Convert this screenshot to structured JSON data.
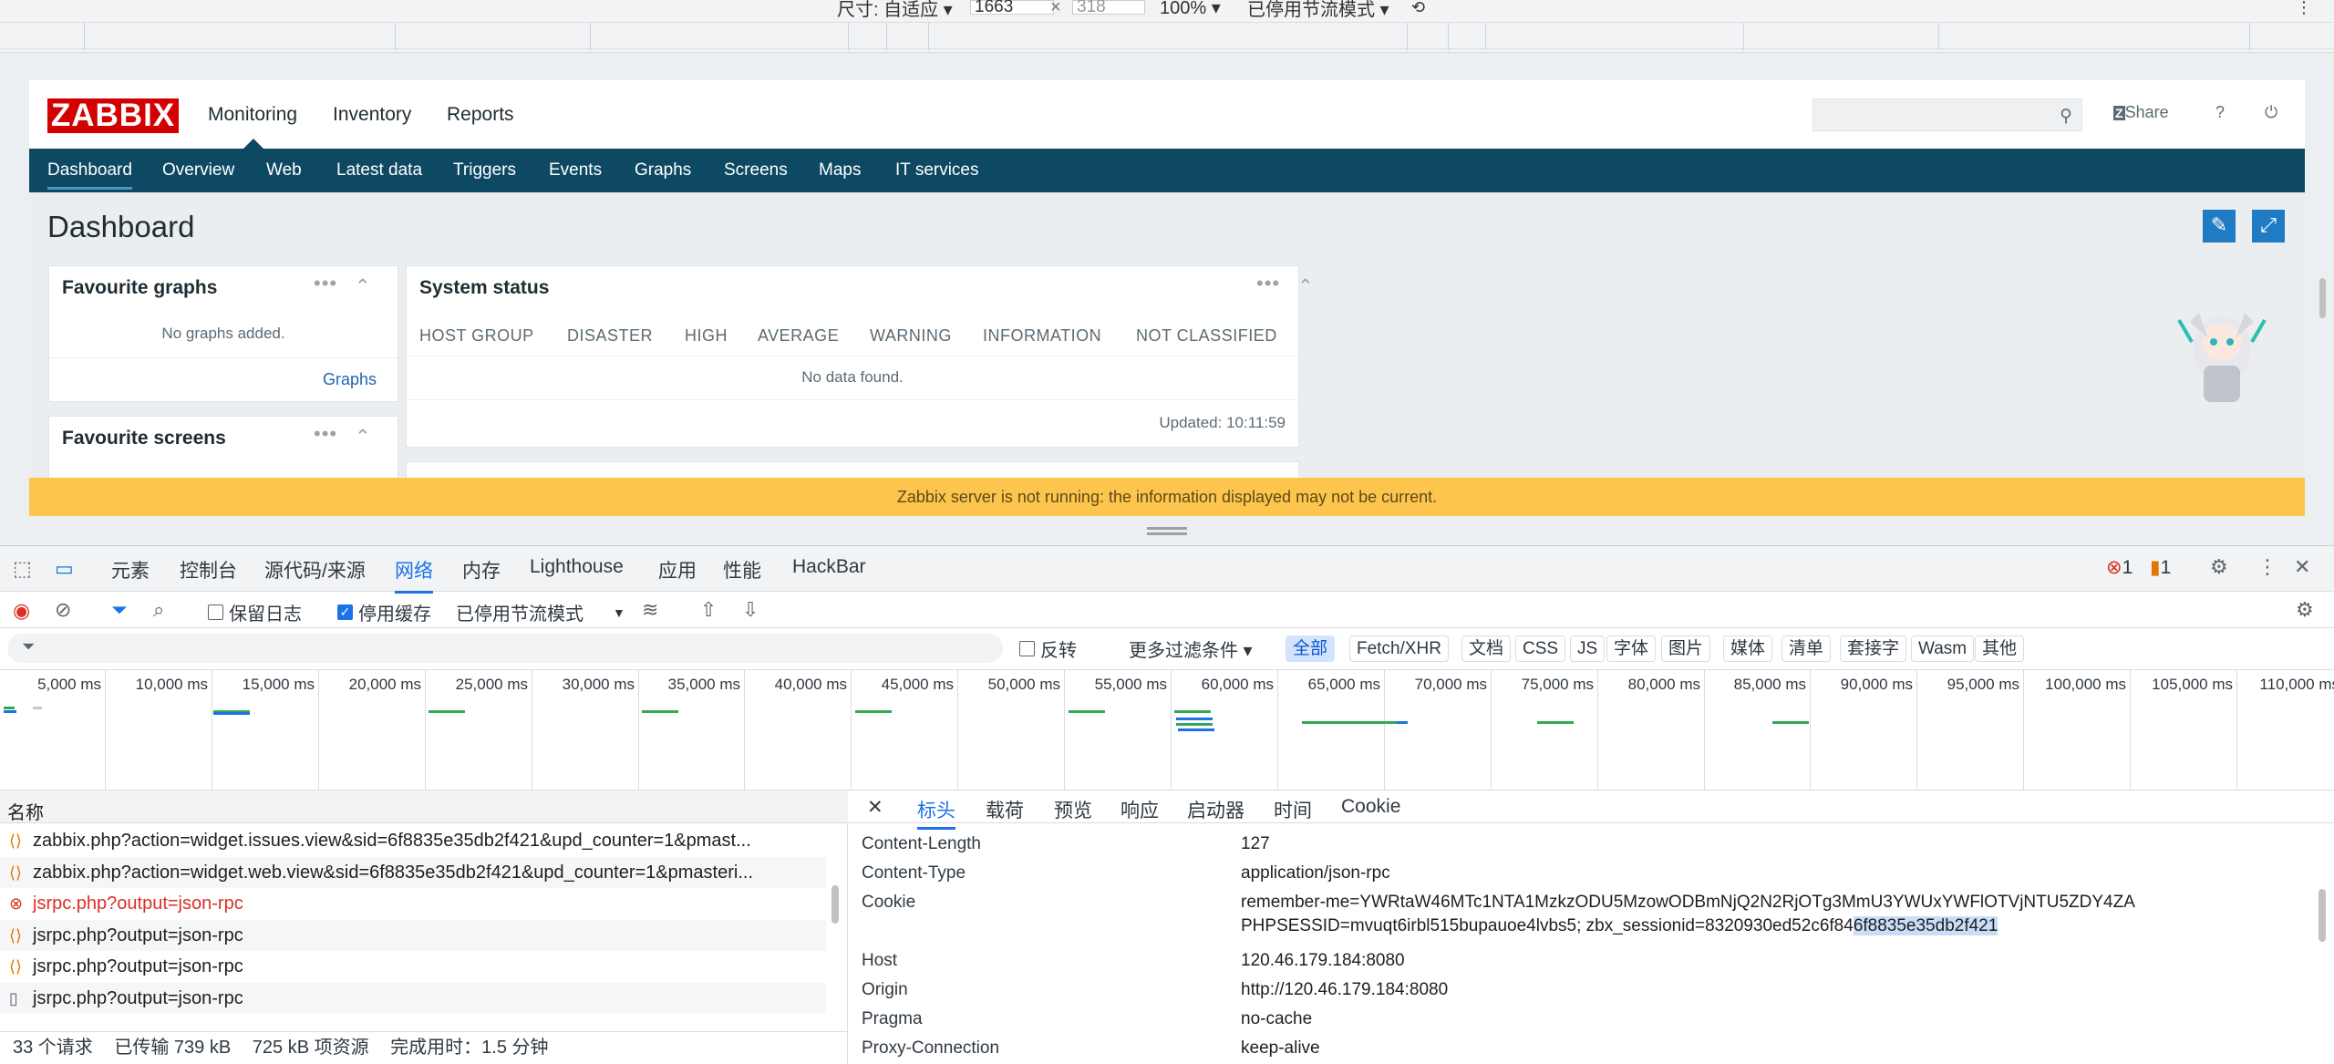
{
  "device_toolbar": {
    "size_label": "尺寸: 自适应 ▾",
    "width_value": "1663",
    "times": "×",
    "height_value": "318",
    "zoom": "100% ▾",
    "throttle": "已停用节流模式 ▾"
  },
  "zabbix": {
    "logo": "ZABBIX",
    "top_nav": [
      "Monitoring",
      "Inventory",
      "Reports"
    ],
    "share": "Share",
    "help": "?",
    "sub_nav": [
      "Dashboard",
      "Overview",
      "Web",
      "Latest data",
      "Triggers",
      "Events",
      "Graphs",
      "Screens",
      "Maps",
      "IT services"
    ],
    "page_title": "Dashboard",
    "fav_graphs": {
      "title": "Favourite graphs",
      "empty": "No graphs added.",
      "link": "Graphs"
    },
    "fav_screens": {
      "title": "Favourite screens"
    },
    "system_status": {
      "title": "System status",
      "columns": [
        "HOST GROUP",
        "DISASTER",
        "HIGH",
        "AVERAGE",
        "WARNING",
        "INFORMATION",
        "NOT CLASSIFIED"
      ],
      "empty": "No data found.",
      "updated": "Updated: 10:11:59"
    },
    "warning": "Zabbix server is not running: the information displayed may not be current."
  },
  "devtools": {
    "tabs": [
      "元素",
      "控制台",
      "源代码/来源",
      "网络",
      "内存",
      "Lighthouse",
      "应用",
      "性能",
      "HackBar"
    ],
    "errors": "1",
    "warnings": "1",
    "toolbar": {
      "preserve_log": "保留日志",
      "disable_cache": "停用缓存",
      "throttle": "已停用节流模式"
    },
    "filter": {
      "invert": "反转",
      "more_filters": "更多过滤条件 ▾"
    },
    "type_filters": [
      "全部",
      "Fetch/XHR",
      "文档",
      "CSS",
      "JS",
      "字体",
      "图片",
      "媒体",
      "清单",
      "套接字",
      "Wasm",
      "其他"
    ],
    "timeline_ticks": [
      "5,000 ms",
      "10,000 ms",
      "15,000 ms",
      "20,000 ms",
      "25,000 ms",
      "30,000 ms",
      "35,000 ms",
      "40,000 ms",
      "45,000 ms",
      "50,000 ms",
      "55,000 ms",
      "60,000 ms",
      "65,000 ms",
      "70,000 ms",
      "75,000 ms",
      "80,000 ms",
      "85,000 ms",
      "90,000 ms",
      "95,000 ms",
      "100,000 ms",
      "105,000 ms",
      "110,000 ms"
    ],
    "name_header": "名称",
    "requests": [
      {
        "name": "zabbix.php?action=widget.issues.view&sid=6f8835e35db2f421&upd_counter=1&pmast...",
        "icon": "xhr-icon",
        "error": false
      },
      {
        "name": "zabbix.php?action=widget.web.view&sid=6f8835e35db2f421&upd_counter=1&pmasteri...",
        "icon": "xhr-icon",
        "error": false
      },
      {
        "name": "jsrpc.php?output=json-rpc",
        "icon": "error-icon",
        "error": true
      },
      {
        "name": "jsrpc.php?output=json-rpc",
        "icon": "xhr-icon",
        "error": false
      },
      {
        "name": "jsrpc.php?output=json-rpc",
        "icon": "xhr-icon",
        "error": false
      },
      {
        "name": "jsrpc.php?output=json-rpc",
        "icon": "document-icon",
        "error": false
      }
    ],
    "summary": {
      "requests": "33 个请求",
      "transferred": "已传输 739 kB",
      "resources": "725 kB 项资源",
      "finish": "完成用时：1.5 分钟"
    },
    "detail_tabs": [
      "标头",
      "载荷",
      "预览",
      "响应",
      "启动器",
      "时间",
      "Cookie"
    ],
    "headers": [
      {
        "key": "Content-Length",
        "value": "127"
      },
      {
        "key": "Content-Type",
        "value": "application/json-rpc"
      },
      {
        "key": "Cookie",
        "value": "remember-me=YWRtaW46MTc1NTA1MzkzODU5MzowODBmNjQ2N2RjOTg3MmU3YWUxYWFlOTVjNTU5ZDY4ZA",
        "value2a": "PHPSESSID=mvuqt6irbl515bupauoe4lvbs5; zbx_sessionid=8320930ed52c6f84",
        "value2b": "6f8835e35db2f421"
      },
      {
        "key": "Host",
        "value": "120.46.179.184:8080"
      },
      {
        "key": "Origin",
        "value": "http://120.46.179.184:8080"
      },
      {
        "key": "Pragma",
        "value": "no-cache"
      },
      {
        "key": "Proxy-Connection",
        "value": "keep-alive"
      }
    ]
  }
}
